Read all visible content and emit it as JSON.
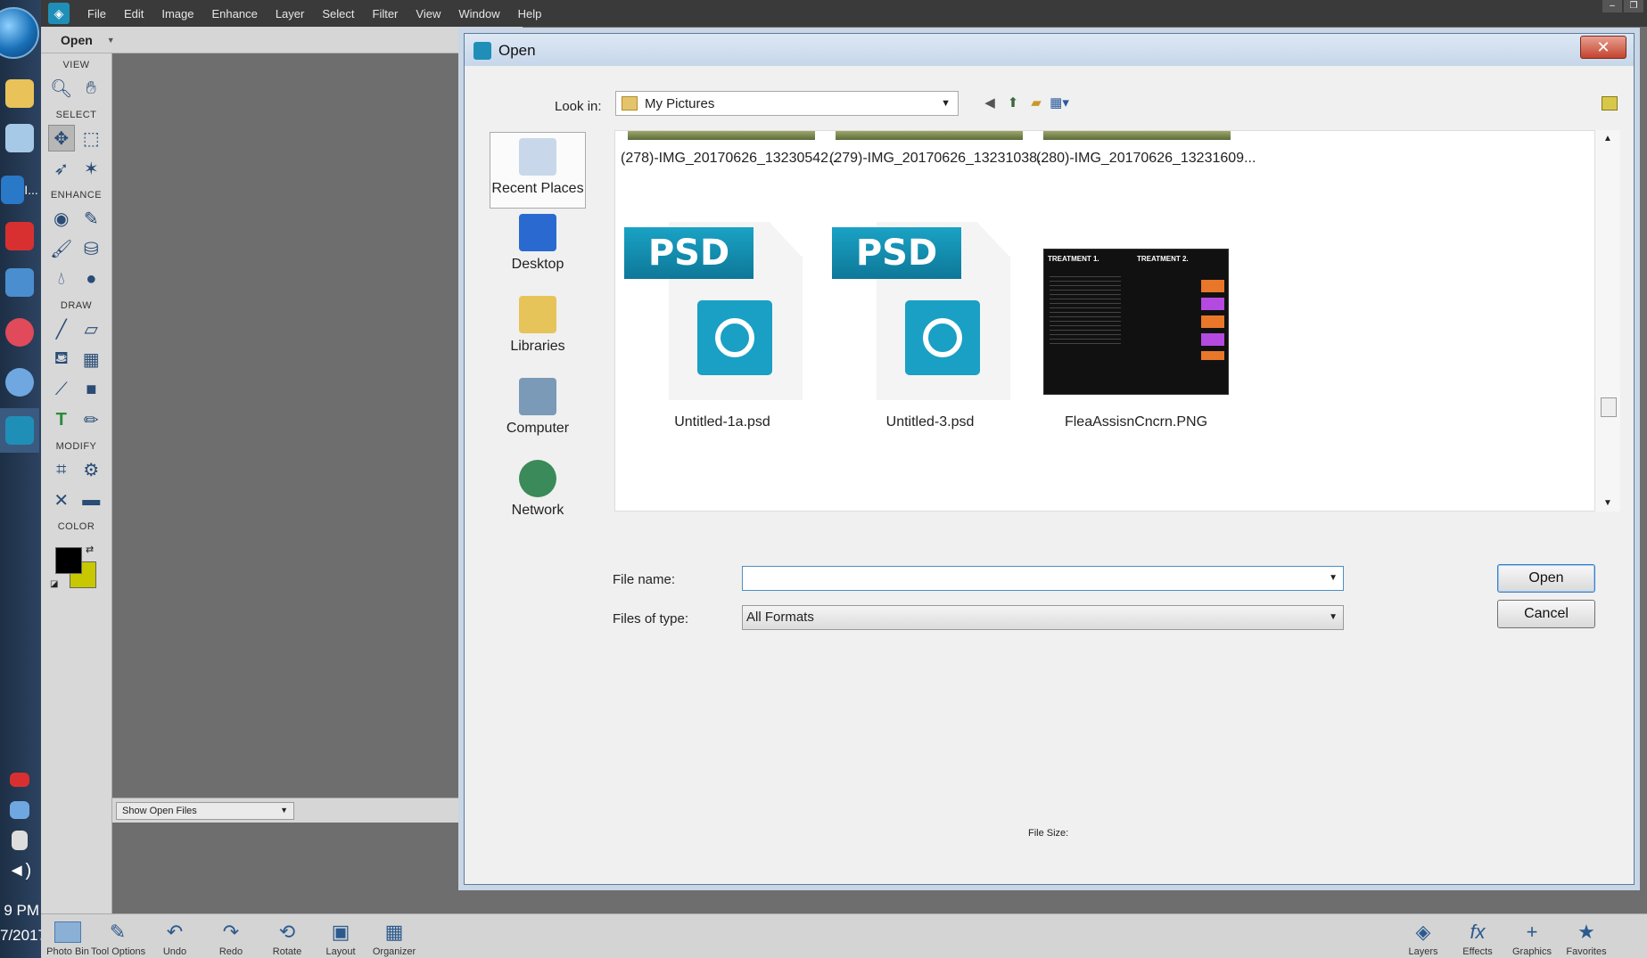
{
  "taskbar": {
    "clock_time": "9 PM",
    "clock_date": "7/2017",
    "pinned_label": "I..."
  },
  "menubar": {
    "items": [
      "File",
      "Edit",
      "Image",
      "Enhance",
      "Layer",
      "Select",
      "Filter",
      "View",
      "Window",
      "Help"
    ]
  },
  "modebar": {
    "open_label": "Open"
  },
  "toolbox": {
    "sections": {
      "view": "VIEW",
      "select": "SELECT",
      "enhance": "ENHANCE",
      "draw": "DRAW",
      "modify": "MODIFY",
      "color": "COLOR"
    },
    "foreground_color": "#000000",
    "background_color": "#c8c800"
  },
  "photo_bin": {
    "dropdown_value": "Show Open Files"
  },
  "bottom_bar": {
    "left": [
      "Photo Bin",
      "Tool Options",
      "Undo",
      "Redo",
      "Rotate",
      "Layout",
      "Organizer"
    ],
    "right": [
      "Layers",
      "Effects",
      "Graphics",
      "Favorites"
    ]
  },
  "dialog": {
    "title": "Open",
    "look_in_label": "Look in:",
    "look_in_value": "My Pictures",
    "places": [
      "Recent Places",
      "Desktop",
      "Libraries",
      "Computer",
      "Network"
    ],
    "top_row_files": [
      "(278)-IMG_20170626_13230542...",
      "(279)-IMG_20170626_13231038...",
      "(280)-IMG_20170626_13231609..."
    ],
    "files": [
      {
        "name": "Untitled-1a.psd",
        "type_badge": "PSD"
      },
      {
        "name": "Untitled-3.psd",
        "type_badge": "PSD"
      },
      {
        "name": "FleaAssisnCncrn.PNG",
        "thumb_title_1": "TREATMENT 1.",
        "thumb_title_2": "TREATMENT 2."
      }
    ],
    "file_name_label": "File name:",
    "file_name_value": "",
    "files_of_type_label": "Files of type:",
    "files_of_type_value": "All Formats",
    "open_button": "Open",
    "cancel_button": "Cancel",
    "file_size_label": "File Size:"
  }
}
